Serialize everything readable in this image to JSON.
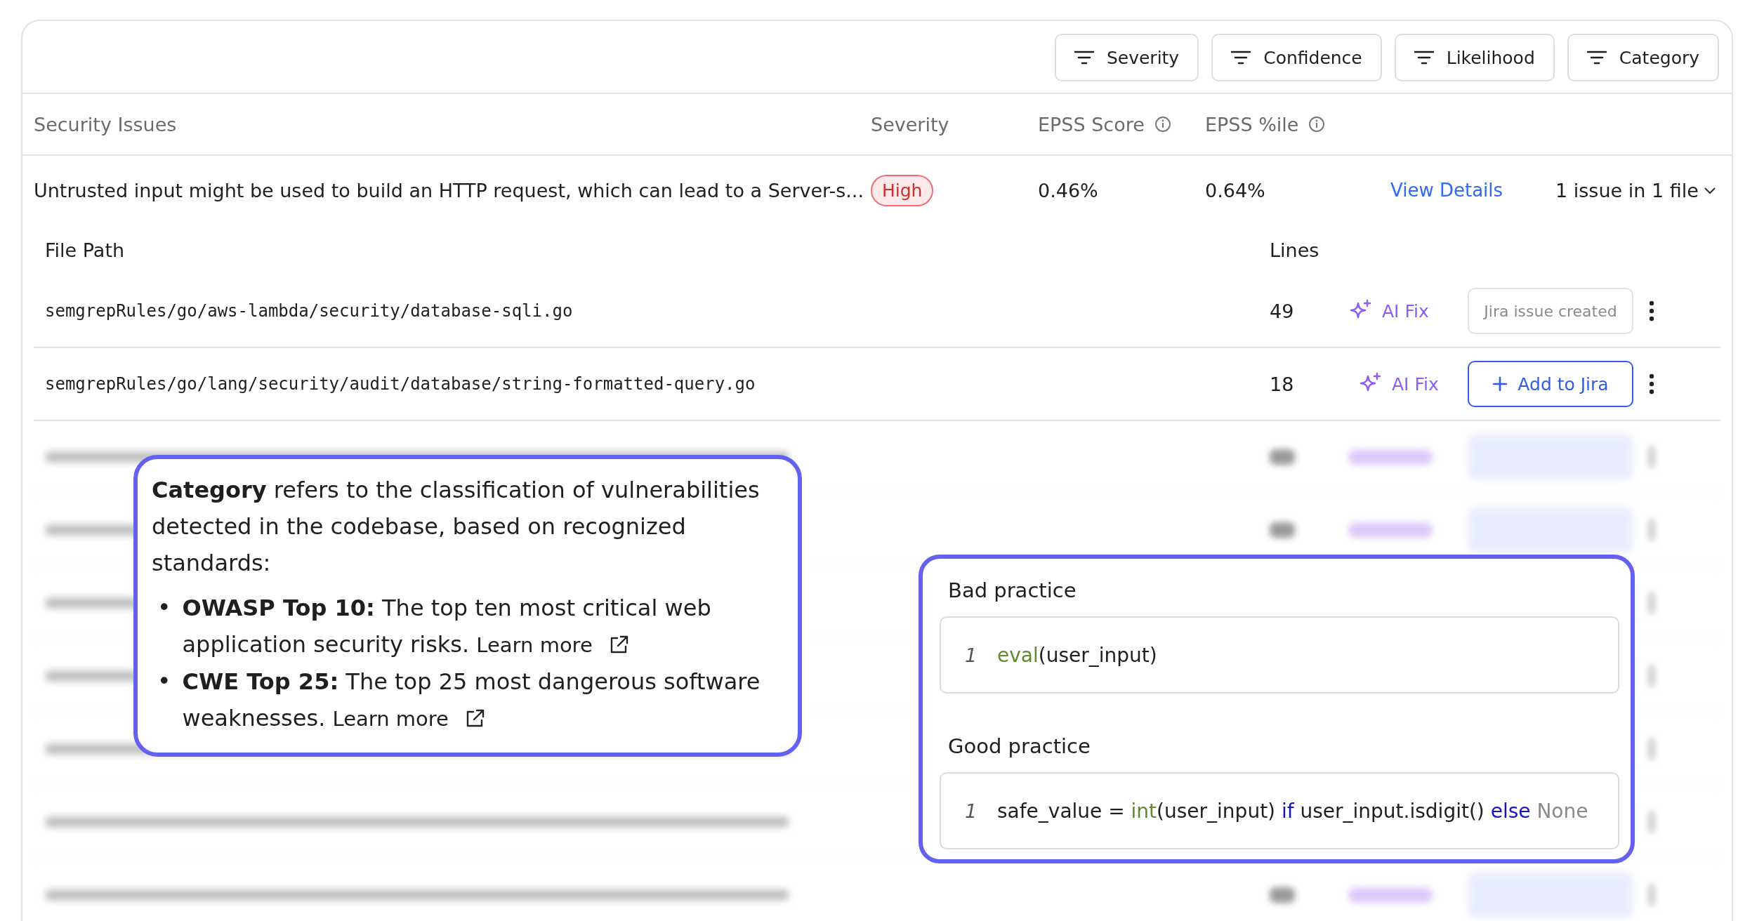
{
  "filters": [
    {
      "label": "Severity"
    },
    {
      "label": "Confidence"
    },
    {
      "label": "Likelihood"
    },
    {
      "label": "Category"
    }
  ],
  "columns": [
    {
      "label": "Security Issues",
      "info": false
    },
    {
      "label": "Severity",
      "info": false
    },
    {
      "label": "EPSS Score",
      "info": true
    },
    {
      "label": "EPSS %ile",
      "info": true
    }
  ],
  "issue": {
    "title": "Untrusted input might be used to build an HTTP request, which can lead to a Server-s...",
    "severity": {
      "label": "High",
      "kind": "high"
    },
    "epss_score": "0.46%",
    "epss_percentile": "0.64%",
    "link": "View Details",
    "summary": "1 issue in 1 file"
  },
  "files": {
    "columns": [
      "File Path",
      "Lines"
    ],
    "rows": [
      {
        "path": "semgrepRules/go/aws-lambda/security/database-sqli.go",
        "lines": "49",
        "ai_fix": "AI Fix",
        "jira": {
          "kind": "created",
          "label": "Jira issue created"
        }
      },
      {
        "path": "semgrepRules/go/lang/security/audit/database/string-formatted-query.go",
        "lines": "18",
        "ai_fix": "AI Fix",
        "jira": {
          "kind": "add",
          "label": "Add to Jira"
        }
      }
    ]
  },
  "tooltip": {
    "intro": "**Category** refers to the classification of vulnerabilities detected in the codebase, based on recognized standards:",
    "items": [
      {
        "marker": "•",
        "text": "**OWASP Top 10:** The top ten most critical web application security risks.",
        "link": "Learn more"
      },
      {
        "marker": "•",
        "text": "**CWE Top 25:** The top 25 most dangerous software weaknesses.",
        "link": "Learn more"
      }
    ]
  },
  "code_examples": [
    {
      "title": "Bad practice",
      "lines": [
        {
          "number": "1",
          "tokens": [
            {
              "text": "eval",
              "kind": "function"
            },
            {
              "text": "(user_input)",
              "kind": "plain"
            }
          ]
        }
      ]
    },
    {
      "title": "Good practice",
      "lines": [
        {
          "number": "1",
          "tokens": [
            {
              "text": "safe_value = ",
              "kind": "plain"
            },
            {
              "text": "int",
              "kind": "function"
            },
            {
              "text": "(user_input) ",
              "kind": "plain"
            },
            {
              "text": "if",
              "kind": "keyword"
            },
            {
              "text": " user_input.isdigit() ",
              "kind": "plain"
            },
            {
              "text": "else",
              "kind": "keyword"
            },
            {
              "text": " None",
              "kind": "constant"
            }
          ]
        }
      ]
    }
  ]
}
